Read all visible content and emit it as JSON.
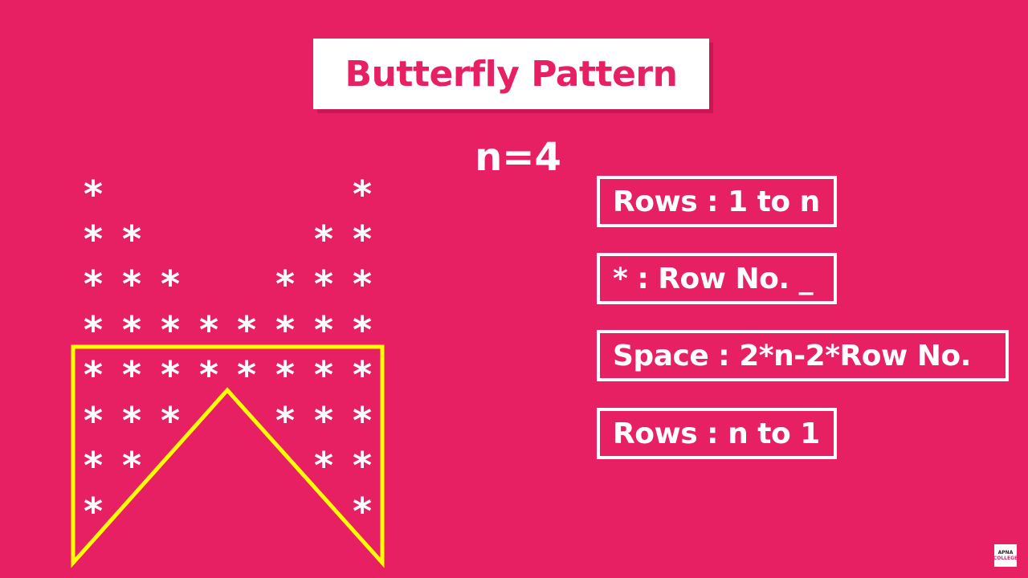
{
  "title": "Butterfly Pattern",
  "n_label": "n=4",
  "star_glyph": "*",
  "pattern_rows": [
    [
      1,
      0,
      0,
      0,
      0,
      0,
      0,
      1
    ],
    [
      1,
      1,
      0,
      0,
      0,
      0,
      1,
      1
    ],
    [
      1,
      1,
      1,
      0,
      0,
      1,
      1,
      1
    ],
    [
      1,
      1,
      1,
      1,
      1,
      1,
      1,
      1
    ],
    [
      1,
      1,
      1,
      1,
      1,
      1,
      1,
      1
    ],
    [
      1,
      1,
      1,
      0,
      0,
      1,
      1,
      1
    ],
    [
      1,
      1,
      0,
      0,
      0,
      0,
      1,
      1
    ],
    [
      1,
      0,
      0,
      0,
      0,
      0,
      0,
      1
    ]
  ],
  "highlight_color": "#ffff00",
  "background_color": "#e62062",
  "rules": [
    "Rows : 1 to n",
    "* : Row No. _",
    "Space : 2*n-2*Row No.",
    "Rows : n to 1"
  ],
  "logo": {
    "line1": "APNA",
    "line2": "COLLEGE"
  }
}
